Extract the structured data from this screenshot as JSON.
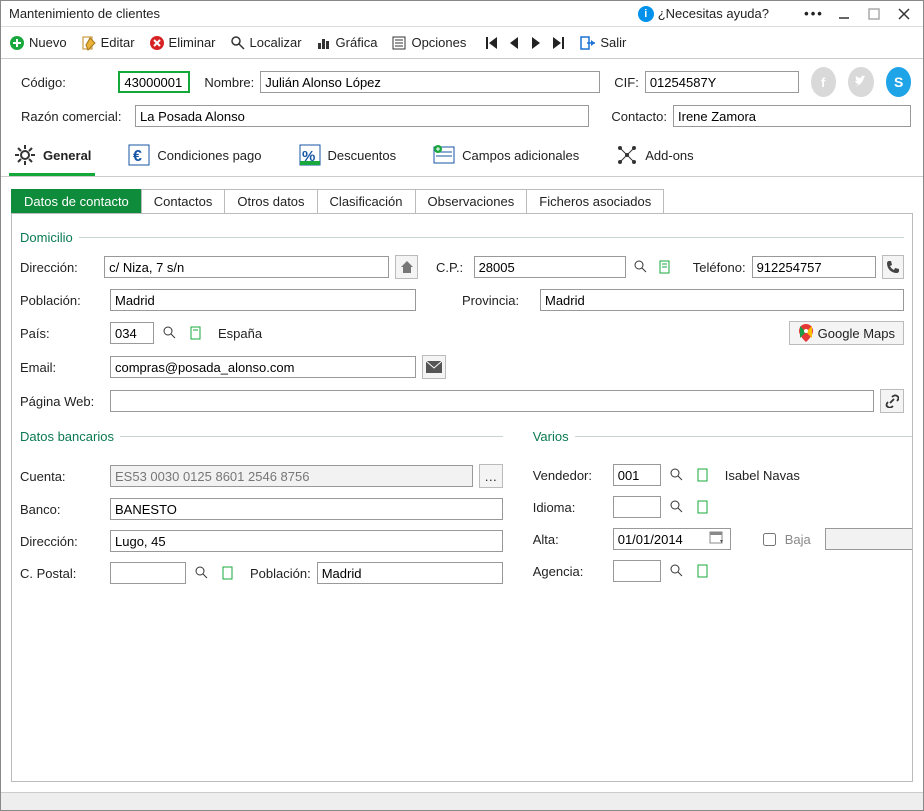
{
  "window": {
    "title": "Mantenimiento de clientes",
    "help": "¿Necesitas ayuda?"
  },
  "toolbar": {
    "nuevo": "Nuevo",
    "editar": "Editar",
    "eliminar": "Eliminar",
    "localizar": "Localizar",
    "grafica": "Gráfica",
    "opciones": "Opciones",
    "salir": "Salir"
  },
  "header": {
    "codigo_lbl": "Código:",
    "codigo": "43000001",
    "nombre_lbl": "Nombre:",
    "nombre": "Julián Alonso López",
    "cif_lbl": "CIF:",
    "cif": "01254587Y",
    "razon_lbl": "Razón comercial:",
    "razon": "La Posada Alonso",
    "contacto_lbl": "Contacto:",
    "contacto": "Irene Zamora"
  },
  "bigtabs": {
    "general": "General",
    "cond": "Condiciones pago",
    "desc": "Descuentos",
    "campos": "Campos adicionales",
    "addons": "Add-ons"
  },
  "subtabs": {
    "datos": "Datos de contacto",
    "contactos": "Contactos",
    "otros": "Otros datos",
    "clasif": "Clasificación",
    "obs": "Observaciones",
    "fich": "Ficheros asociados"
  },
  "domicilio": {
    "legend": "Domicilio",
    "direccion_lbl": "Dirección:",
    "direccion": "c/ Niza, 7 s/n",
    "cp_lbl": "C.P.:",
    "cp": "28005",
    "telefono_lbl": "Teléfono:",
    "telefono": "912254757",
    "poblacion_lbl": "Población:",
    "poblacion": "Madrid",
    "provincia_lbl": "Provincia:",
    "provincia": "Madrid",
    "pais_lbl": "País:",
    "pais_code": "034",
    "pais_name": "España",
    "gmaps": "Google Maps",
    "email_lbl": "Email:",
    "email": "compras@posada_alonso.com",
    "web_lbl": "Página Web:",
    "web": ""
  },
  "bancarios": {
    "legend": "Datos bancarios",
    "cuenta_lbl": "Cuenta:",
    "cuenta": "ES53 0030 0125 8601 2546 8756",
    "banco_lbl": "Banco:",
    "banco": "BANESTO",
    "direccion_lbl": "Dirección:",
    "direccion": "Lugo, 45",
    "cp_lbl": "C. Postal:",
    "cp": "",
    "poblacion_lbl": "Población:",
    "poblacion": "Madrid"
  },
  "varios": {
    "legend": "Varios",
    "vendedor_lbl": "Vendedor:",
    "vendedor": "001",
    "vendedor_name": "Isabel Navas",
    "idioma_lbl": "Idioma:",
    "idioma": "",
    "alta_lbl": "Alta:",
    "alta": "01/01/2014",
    "baja_lbl": "Baja",
    "baja_checked": false,
    "baja_date": "",
    "agencia_lbl": "Agencia:",
    "agencia": ""
  }
}
